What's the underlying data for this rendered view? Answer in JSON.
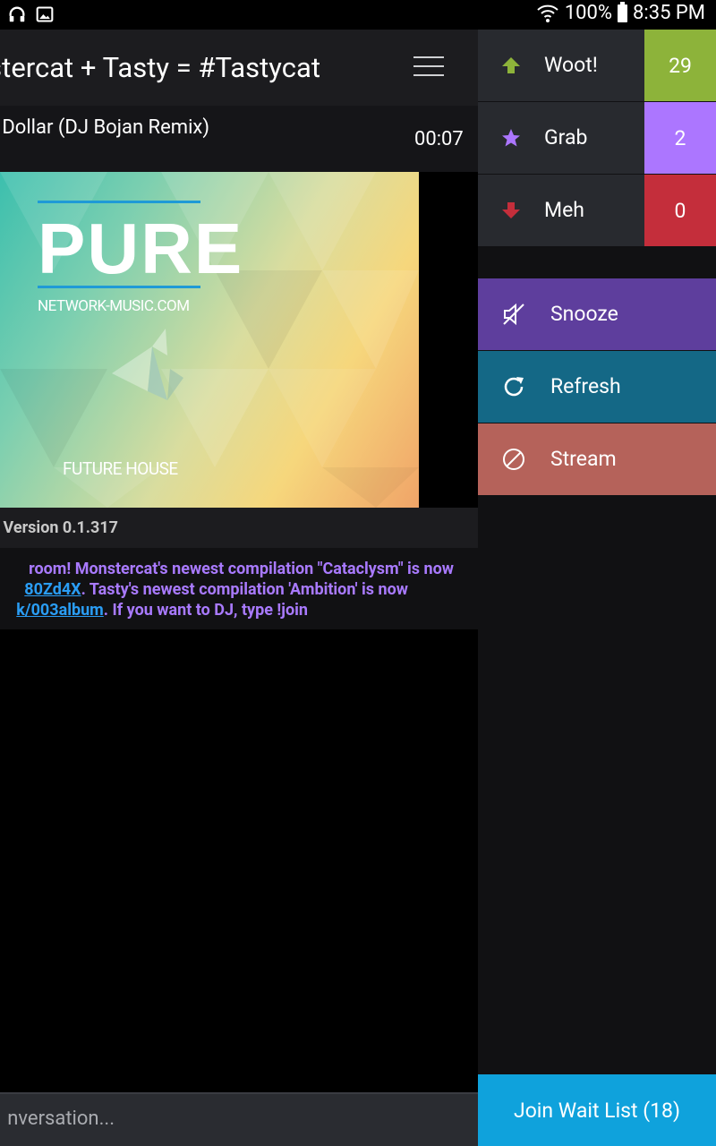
{
  "status_bar": {
    "battery": "100%",
    "time": "8:35 PM",
    "icons": [
      "headphones-icon",
      "image-icon",
      "wifi-icon",
      "battery-icon"
    ]
  },
  "room": {
    "title": "Monstercat + Tasty = #Tastycat",
    "menu_icon": "hamburger-menu-icon"
  },
  "now_playing": {
    "track": "Dollar (DJ Bojan Remix)",
    "elapsed": "00:07"
  },
  "artwork": {
    "logo_text": "PURE",
    "subtitle": "NETWORK-MUSIC.COM",
    "footer": "FUTURE HOUSE"
  },
  "version": "Version 0.1.317",
  "welcome_message": {
    "line1": "room! Monstercat's newest compilation \"Cataclysm\" is now",
    "line2_link": "80Zd4X",
    "line2_text": ". Tasty's newest compilation 'Ambition' is now",
    "line3_link": "k/003album",
    "line3_text": ". If you want to DJ, type !join"
  },
  "chat_input": {
    "placeholder": "nversation..."
  },
  "votes": [
    {
      "label": "Woot!",
      "count": "29",
      "icon": "arrow-up-icon",
      "color": "#8db33a"
    },
    {
      "label": "Grab",
      "count": "2",
      "icon": "star-icon",
      "color": "#ac76ff"
    },
    {
      "label": "Meh",
      "count": "0",
      "icon": "arrow-down-icon",
      "color": "#c42e3b"
    }
  ],
  "actions": [
    {
      "label": "Snooze",
      "icon": "mute-icon",
      "color": "#5e3e9d"
    },
    {
      "label": "Refresh",
      "icon": "refresh-icon",
      "color": "#146886"
    },
    {
      "label": "Stream",
      "icon": "disable-icon",
      "color": "#b5625a"
    }
  ],
  "join_wait_list": "Join Wait List (18)",
  "colors": {
    "woot": "#8db33a",
    "grab": "#ac76ff",
    "meh": "#c42e3b",
    "join": "#0fa2dc",
    "link": "#2a9df4",
    "chat_text": "#a97aff"
  }
}
